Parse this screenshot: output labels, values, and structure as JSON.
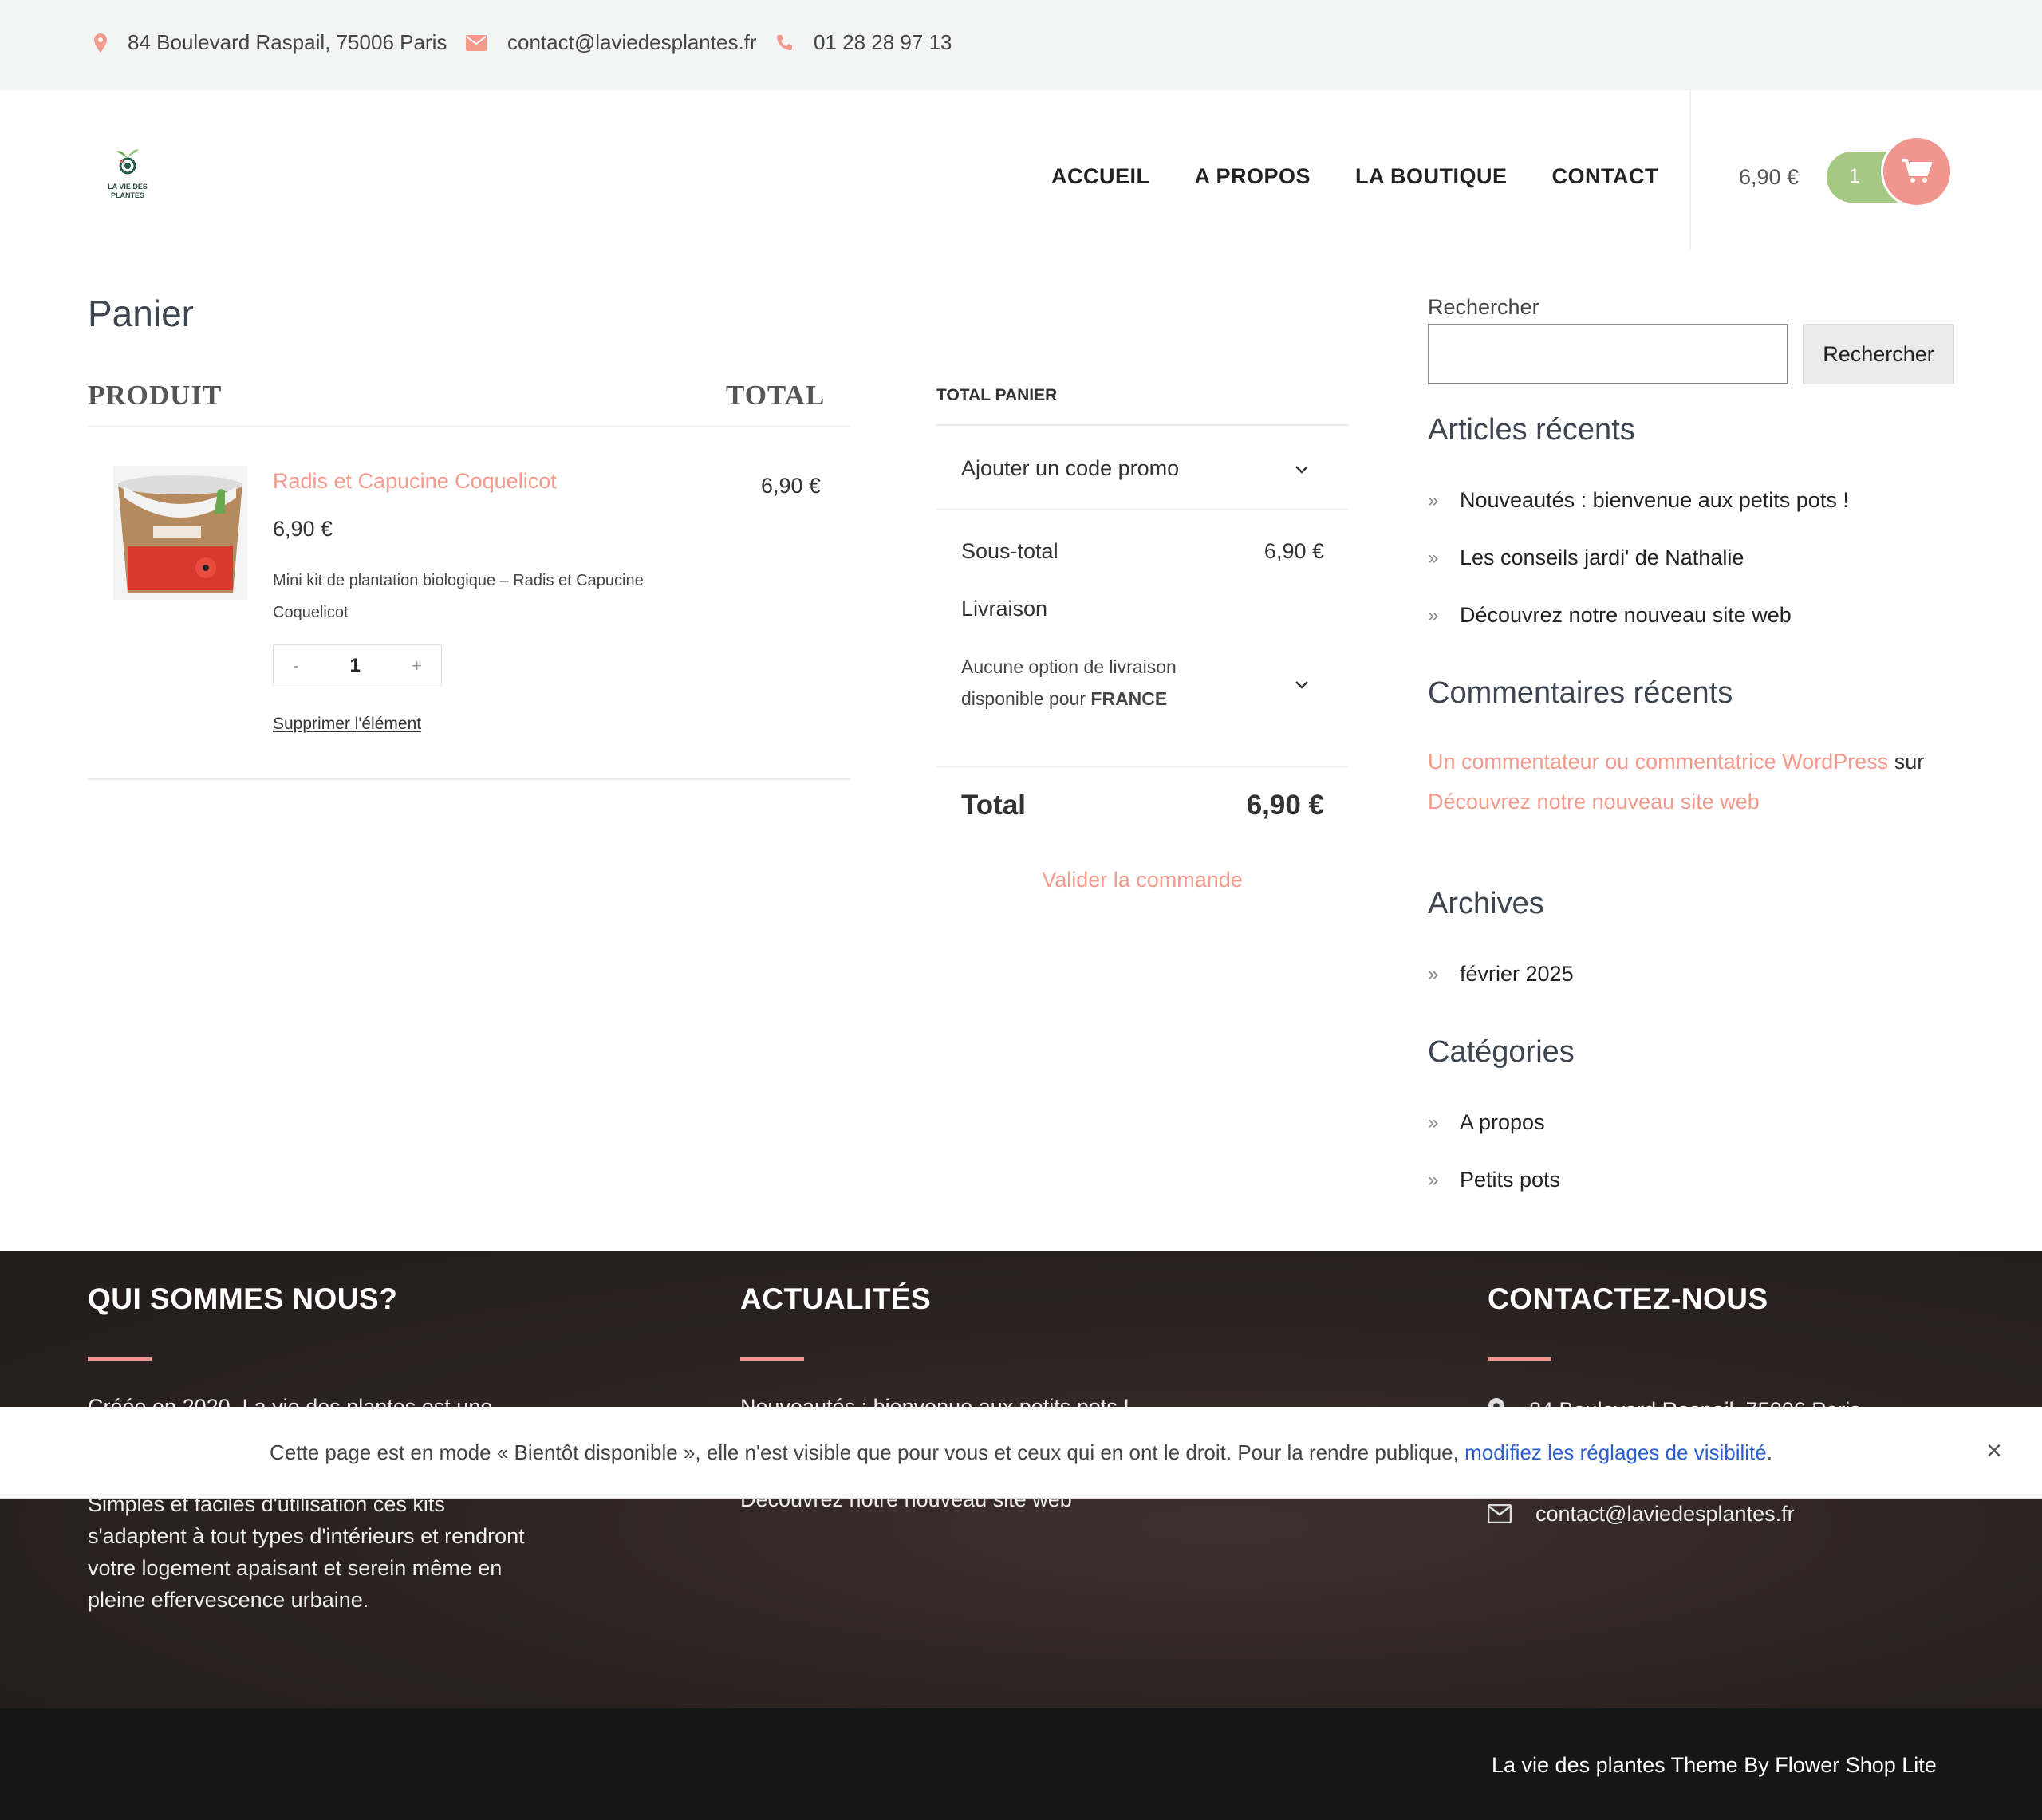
{
  "topbar": {
    "address": "84 Boulevard Raspail, 75006 Paris",
    "email": "contact@laviedesplantes.fr",
    "phone": "01 28 28 97 13"
  },
  "logo": {
    "line1": "LA VIE DES",
    "line2": "PLANTES"
  },
  "nav": [
    "ACCUEIL",
    "A PROPOS",
    "LA BOUTIQUE",
    "CONTACT"
  ],
  "cart": {
    "price": "6,90 €",
    "count": "1"
  },
  "page": {
    "title": "Panier"
  },
  "cart_table": {
    "col_product": "PRODUIT",
    "col_total": "TOTAL",
    "item": {
      "name": "Radis et Capucine Coquelicot",
      "price": "6,90 €",
      "description": "Mini kit de plantation biologique – Radis et Capucine Coquelicot",
      "qty_minus": "-",
      "qty": "1",
      "qty_plus": "+",
      "remove": "Supprimer l'élément",
      "line_total": "6,90 €",
      "image_label": "POT DE CULTURE COQUELICOT"
    }
  },
  "totals": {
    "title": "TOTAL PANIER",
    "promo": "Ajouter un code promo",
    "subtotal_label": "Sous-total",
    "subtotal_value": "6,90 €",
    "shipping_label": "Livraison",
    "shipping_note_1": "Aucune option de livraison",
    "shipping_note_2": "disponible pour",
    "shipping_country": "FRANCE",
    "total_label": "Total",
    "total_value": "6,90 €",
    "checkout": "Valider la commande"
  },
  "sidebar": {
    "search_label": "Rechercher",
    "search_button": "Rechercher",
    "recent_title": "Articles récents",
    "recent": [
      "Nouveautés : bienvenue aux petits pots !",
      "Les conseils jardi' de Nathalie",
      "Découvrez notre nouveau site web"
    ],
    "comments_title": "Commentaires récents",
    "comment_author": "Un commentateur ou commentatrice WordPress",
    "comment_on": "sur",
    "comment_post": "Découvrez notre nouveau site web",
    "archives_title": "Archives",
    "archives": [
      "février 2025"
    ],
    "categories_title": "Catégories",
    "categories": [
      "A propos",
      "Petits pots"
    ]
  },
  "footer": {
    "about_title": "QUI SOMMES NOUS?",
    "about_line1": "Créée en 2020, La vie des plantes est une",
    "about_rest": [
      "Simples et faciles d'utilisation ces kits",
      "s'adaptent à tout types d'intérieurs et rendront",
      "votre logement apaisant et serein même en",
      "pleine effervescence urbaine."
    ],
    "news_title": "ACTUALITÉS",
    "news_1": "Nouveautés : bienvenue aux petits pots !",
    "news_3": "Découvrez notre nouveau site web",
    "contact_title": "CONTACTEZ-NOUS",
    "contact_address": "84 Boulevard Raspail, 75006 Paris",
    "contact_email": "contact@laviedesplantes.fr",
    "credits": "La vie des plantes Theme By Flower Shop Lite"
  },
  "notice": {
    "text": "Cette page est en mode « Bientôt disponible », elle n'est visible que pour vous et ceux qui en ont le droit. Pour la rendre publique,",
    "link": "modifiez les réglages de visibilité",
    "end": ".",
    "close": "×"
  },
  "colors": {
    "accent": "#f39a8c",
    "cart_green": "#a5c882",
    "footer_bg": "#2d2422",
    "link_blue": "#2c5ecf"
  }
}
